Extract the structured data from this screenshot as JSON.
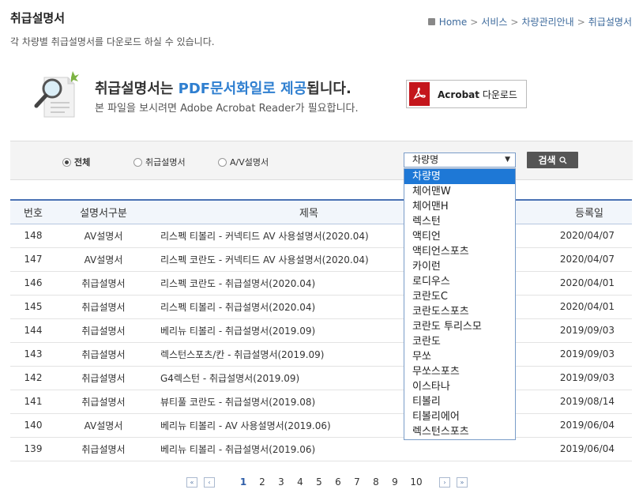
{
  "page": {
    "title": "취급설명서",
    "subtitle": "각 차량별 취급설명서를 다운로드 하실 수 있습니다."
  },
  "breadcrumb": [
    "Home",
    "서비스",
    "차량관리안내",
    "취급설명서"
  ],
  "banner": {
    "title_pre": "취급설명서는 ",
    "title_hl": "PDF문서화일로 제공",
    "title_post": "됩니다.",
    "sub": "본 파일을 보시려면 Adobe Acrobat Reader가 필요합니다.",
    "acrobat_bold": "Acrobat",
    "acrobat_rest": " 다운로드"
  },
  "filter": {
    "radios": [
      "전체",
      "취급설명서",
      "A/V설명서"
    ],
    "selected_radio": "전체",
    "select_value": "차량명",
    "search_label": "검색",
    "options": [
      "차량명",
      "체어맨W",
      "체어맨H",
      "렉스턴",
      "액티언",
      "액티언스포츠",
      "카이런",
      "로디우스",
      "코란도C",
      "코란도스포츠",
      "코란도 투리스모",
      "코란도",
      "무쏘",
      "무쏘스포츠",
      "이스타나",
      "티볼리",
      "티볼리에어",
      "렉스턴스포츠"
    ]
  },
  "table": {
    "headers": [
      "번호",
      "설명서구분",
      "제목",
      "등록일"
    ],
    "rows": [
      {
        "no": "148",
        "type": "AV설명서",
        "title": "리스펙 티볼리 - 커넥티드 AV 사용설명서(2020.04)",
        "date": "2020/04/07"
      },
      {
        "no": "147",
        "type": "AV설명서",
        "title": "리스펙 코란도 - 커넥티드 AV 사용설명서(2020.04)",
        "date": "2020/04/07"
      },
      {
        "no": "146",
        "type": "취급설명서",
        "title": "리스펙 코란도 - 취급설명서(2020.04)",
        "date": "2020/04/01"
      },
      {
        "no": "145",
        "type": "취급설명서",
        "title": "리스펙 티볼리 - 취급설명서(2020.04)",
        "date": "2020/04/01"
      },
      {
        "no": "144",
        "type": "취급설명서",
        "title": "베리뉴 티볼리 - 취급설명서(2019.09)",
        "date": "2019/09/03"
      },
      {
        "no": "143",
        "type": "취급설명서",
        "title": "렉스턴스포츠/칸 - 취급설명서(2019.09)",
        "date": "2019/09/03"
      },
      {
        "no": "142",
        "type": "취급설명서",
        "title": "G4렉스턴 - 취급설명서(2019.09)",
        "date": "2019/09/03"
      },
      {
        "no": "141",
        "type": "취급설명서",
        "title": "뷰티풀 코란도 - 취급설명서(2019.08)",
        "date": "2019/08/14"
      },
      {
        "no": "140",
        "type": "AV설명서",
        "title": "베리뉴 티볼리 - AV 사용설명서(2019.06)",
        "date": "2019/06/04"
      },
      {
        "no": "139",
        "type": "취급설명서",
        "title": "베리뉴 티볼리 - 취급설명서(2019.06)",
        "date": "2019/06/04"
      }
    ]
  },
  "pager": {
    "first": "«",
    "prev": "‹",
    "next": "›",
    "last": "»",
    "pages": [
      "1",
      "2",
      "3",
      "4",
      "5",
      "6",
      "7",
      "8",
      "9",
      "10"
    ],
    "current": "1"
  }
}
